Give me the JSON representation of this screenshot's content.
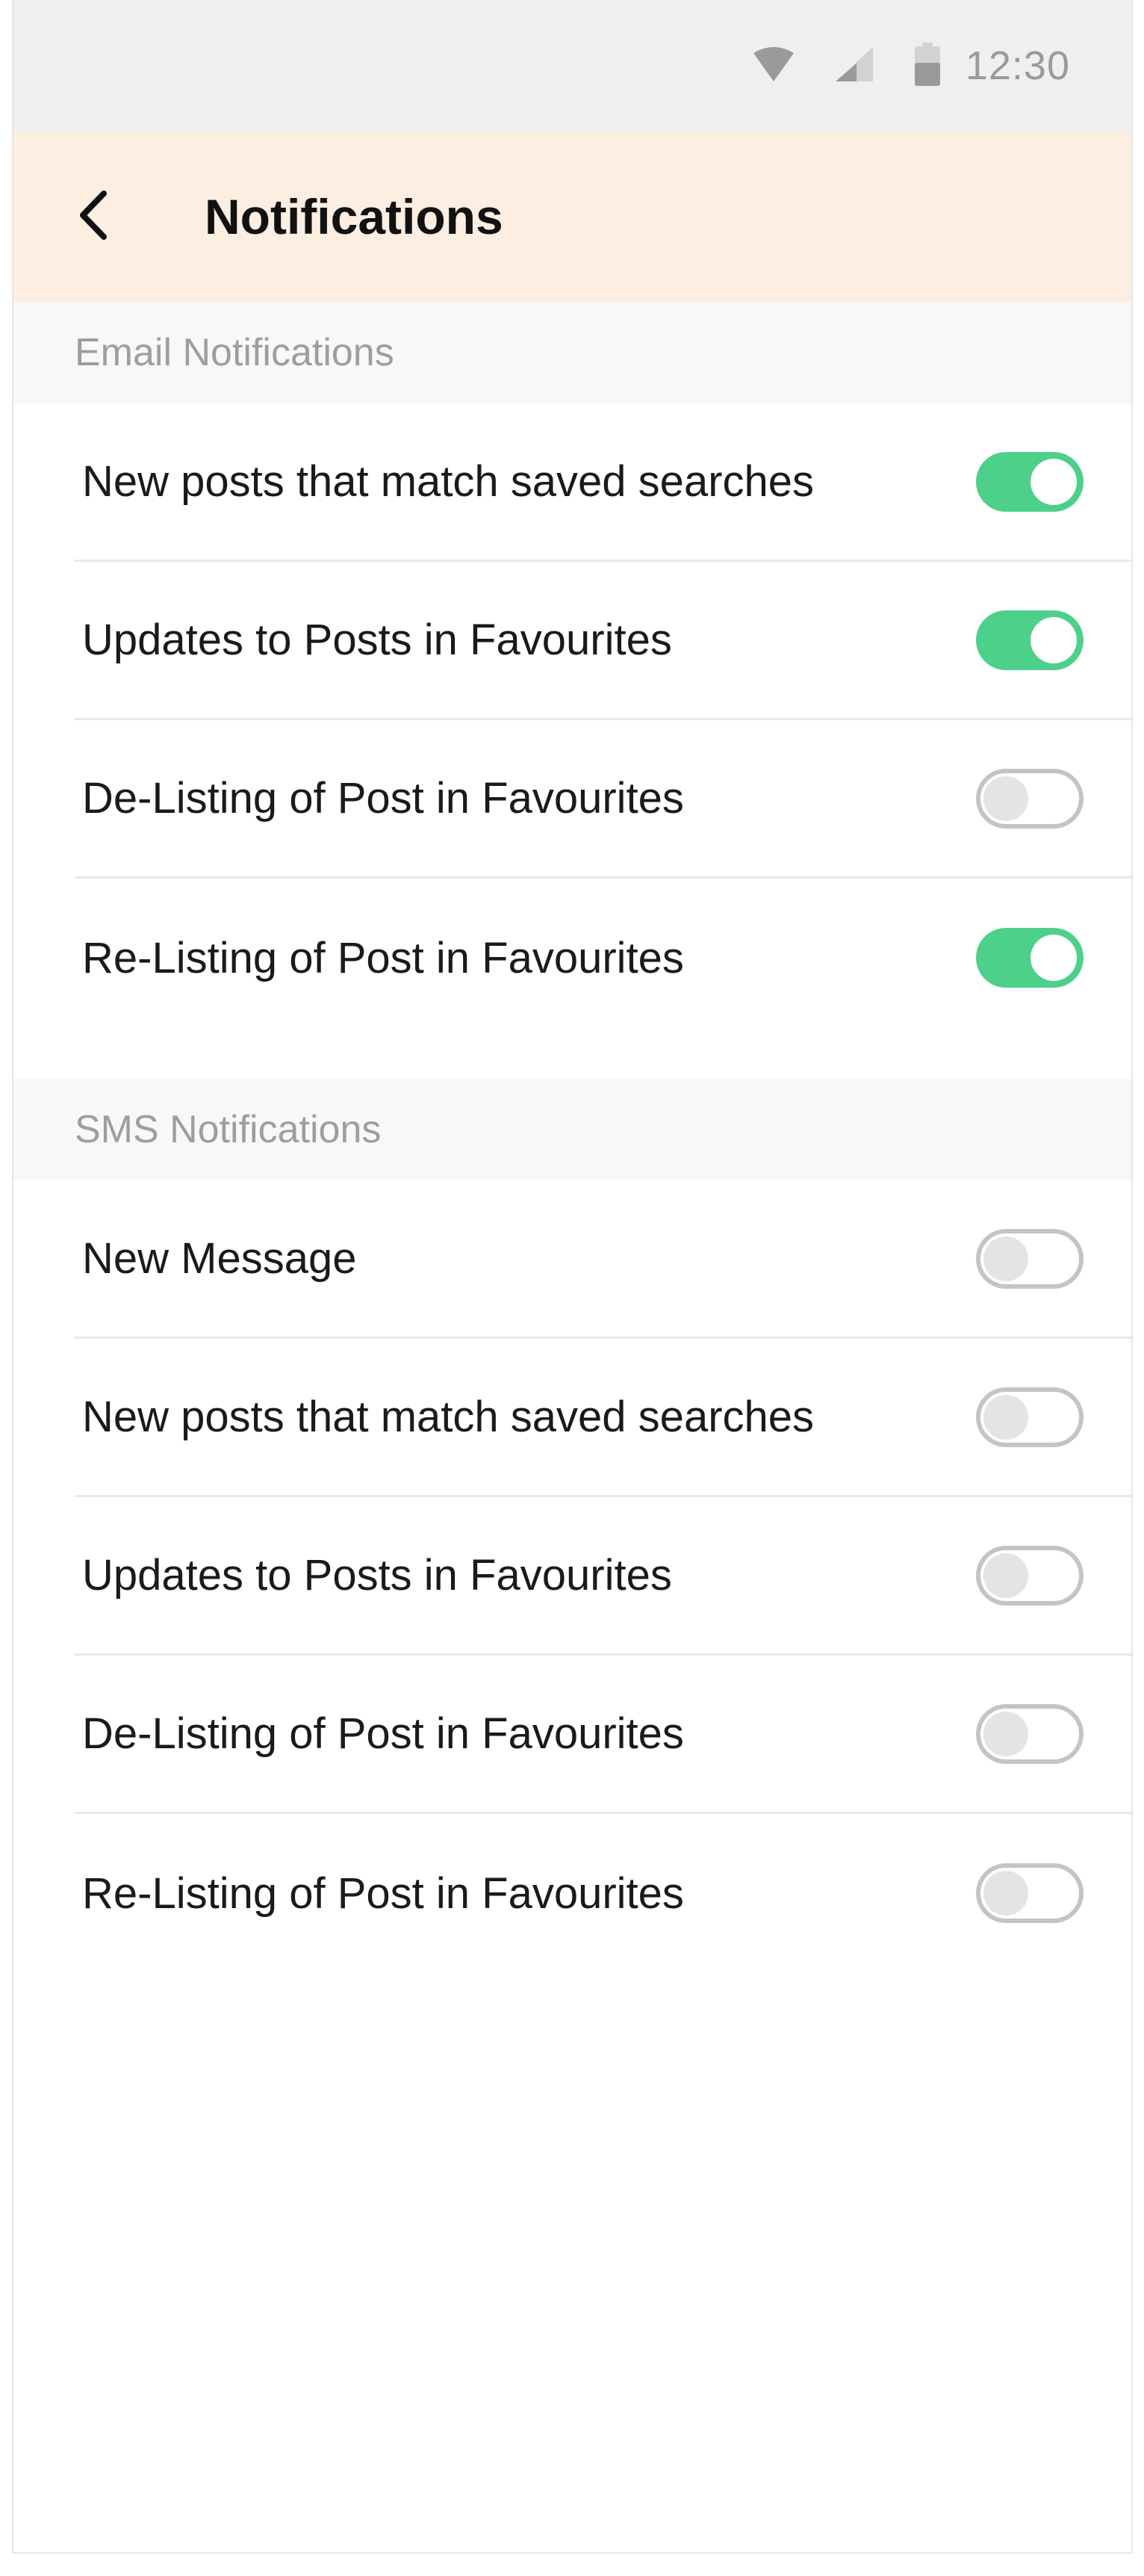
{
  "status_bar": {
    "time": "12:30",
    "icons": [
      "wifi-icon",
      "signal-icon",
      "battery-icon"
    ]
  },
  "header": {
    "title": "Notifications",
    "back_icon": "chevron-left-icon"
  },
  "colors": {
    "header_bg": "#fdeee2",
    "toggle_on": "#4dd08a",
    "toggle_off_border": "#c4c4c4"
  },
  "email_section": {
    "title": "Email Notifications",
    "items": [
      {
        "label": "New posts that match saved searches",
        "enabled": true
      },
      {
        "label": "Updates to Posts in Favourites",
        "enabled": true
      },
      {
        "label": "De-Listing of Post in Favourites",
        "enabled": false
      },
      {
        "label": "Re-Listing of Post in Favourites",
        "enabled": true
      }
    ]
  },
  "sms_section": {
    "title": "SMS Notifications",
    "items": [
      {
        "label": "New Message",
        "enabled": false
      },
      {
        "label": "New posts that match saved searches",
        "enabled": false
      },
      {
        "label": "Updates to Posts in Favourites",
        "enabled": false
      },
      {
        "label": "De-Listing of Post in Favourites",
        "enabled": false
      },
      {
        "label": "Re-Listing of Post in Favourites",
        "enabled": false
      }
    ]
  }
}
